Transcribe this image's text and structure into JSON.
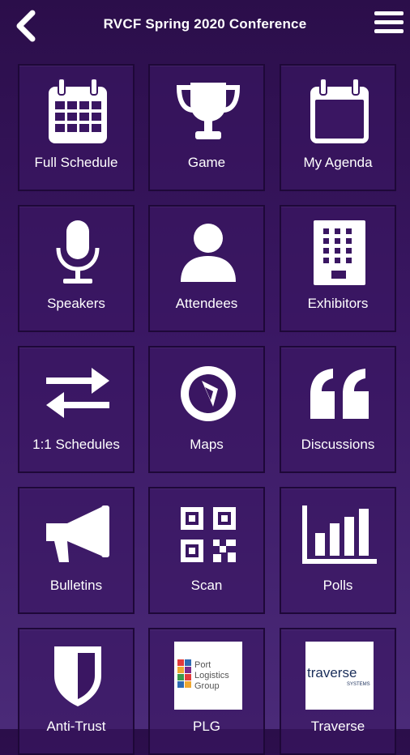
{
  "header": {
    "title": "RVCF Spring 2020 Conference"
  },
  "tiles": [
    {
      "label": "Full Schedule",
      "icon": "calendar-grid-icon"
    },
    {
      "label": "Game",
      "icon": "trophy-icon"
    },
    {
      "label": "My Agenda",
      "icon": "calendar-icon"
    },
    {
      "label": "Speakers",
      "icon": "microphone-icon"
    },
    {
      "label": "Attendees",
      "icon": "person-icon"
    },
    {
      "label": "Exhibitors",
      "icon": "building-icon"
    },
    {
      "label": "1:1 Schedules",
      "icon": "swap-arrows-icon"
    },
    {
      "label": "Maps",
      "icon": "compass-icon"
    },
    {
      "label": "Discussions",
      "icon": "quote-icon"
    },
    {
      "label": "Bulletins",
      "icon": "megaphone-icon"
    },
    {
      "label": "Scan",
      "icon": "qr-code-icon"
    },
    {
      "label": "Polls",
      "icon": "bar-chart-icon"
    },
    {
      "label": "Anti-Trust",
      "icon": "shield-icon"
    },
    {
      "label": "PLG",
      "icon": "port-logistics-group-logo",
      "logo_text": [
        "Port",
        "Logistics",
        "Group"
      ]
    },
    {
      "label": "Traverse",
      "icon": "traverse-logo",
      "logo_text": [
        "traverse",
        "SYSTEMS"
      ]
    }
  ],
  "colors": {
    "background": "#3a1763",
    "tile": "#3a1662",
    "tile_border": "#1e0838",
    "text": "#ffffff"
  }
}
